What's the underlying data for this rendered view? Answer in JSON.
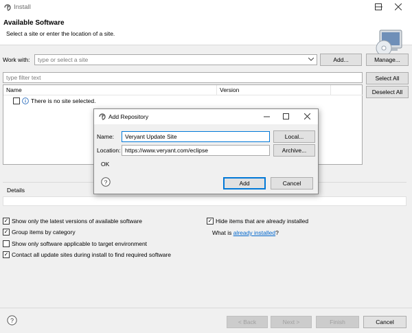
{
  "window": {
    "title": "Install",
    "controls": [
      "minimize-icon",
      "maximize-icon",
      "close-icon"
    ]
  },
  "banner": {
    "heading": "Available Software",
    "subtitle": "Select a site or enter the location of a site."
  },
  "work_with": {
    "label": "Work with:",
    "placeholder": "type or select a site",
    "add_label": "Add...",
    "manage_label": "Manage..."
  },
  "filter": {
    "placeholder": "type filter text",
    "select_all_label": "Select All",
    "deselect_all_label": "Deselect All"
  },
  "table": {
    "columns": [
      "Name",
      "Version"
    ],
    "rows": [
      {
        "text": "There is no site selected."
      }
    ]
  },
  "details": {
    "label": "Details"
  },
  "options": {
    "latest_versions": {
      "label": "Show only the latest versions of available software",
      "checked": true
    },
    "group_by_category": {
      "label": "Group items by category",
      "checked": true
    },
    "target_env": {
      "label": "Show only software applicable to target environment",
      "checked": false
    },
    "contact_sites": {
      "label": "Contact all update sites during install to find required software",
      "checked": true
    },
    "hide_installed": {
      "label": "Hide items that are already installed",
      "checked": true
    },
    "what_is_prefix": "What is ",
    "what_is_link": "already installed",
    "what_is_suffix": "?"
  },
  "footer": {
    "back_label": "< Back",
    "next_label": "Next >",
    "finish_label": "Finish",
    "cancel_label": "Cancel"
  },
  "dialog": {
    "title": "Add Repository",
    "name_label": "Name:",
    "name_value": "Veryant Update Site",
    "location_label": "Location:",
    "location_value": "https://www.veryant.com/eclipse",
    "local_label": "Local...",
    "archive_label": "Archive...",
    "status": "OK",
    "add_label": "Add",
    "cancel_label": "Cancel"
  },
  "colors": {
    "accent": "#0078d7",
    "link": "#0066cc",
    "info": "#2a6dbd"
  }
}
